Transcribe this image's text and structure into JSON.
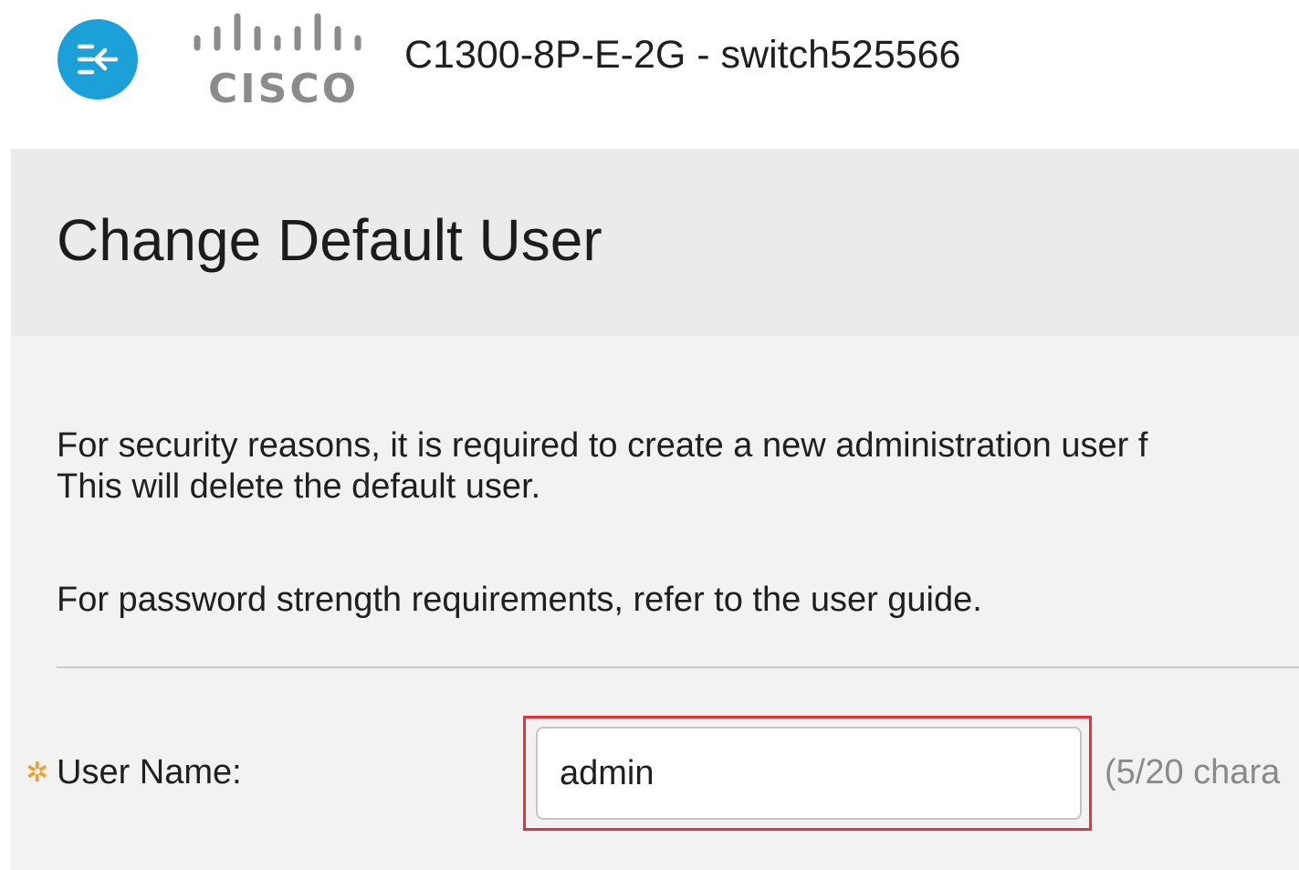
{
  "header": {
    "device_title": "C1300-8P-E-2G - switch525566",
    "logo_text": "CISCO",
    "nav_icon": "collapse-menu-icon"
  },
  "page": {
    "title": "Change Default User",
    "info_line_1": "For security reasons, it is required to create a new administration user f",
    "info_line_2": "This will delete the default user.",
    "info_line_3": "For password strength requirements, refer to the user guide."
  },
  "form": {
    "username": {
      "required_icon": "✲",
      "label": "User Name:",
      "value": "admin",
      "char_count": "(5/20 chara"
    }
  },
  "colors": {
    "accent": "#1ba0d7",
    "highlight": "#e5333d",
    "required": "#f0a020"
  }
}
